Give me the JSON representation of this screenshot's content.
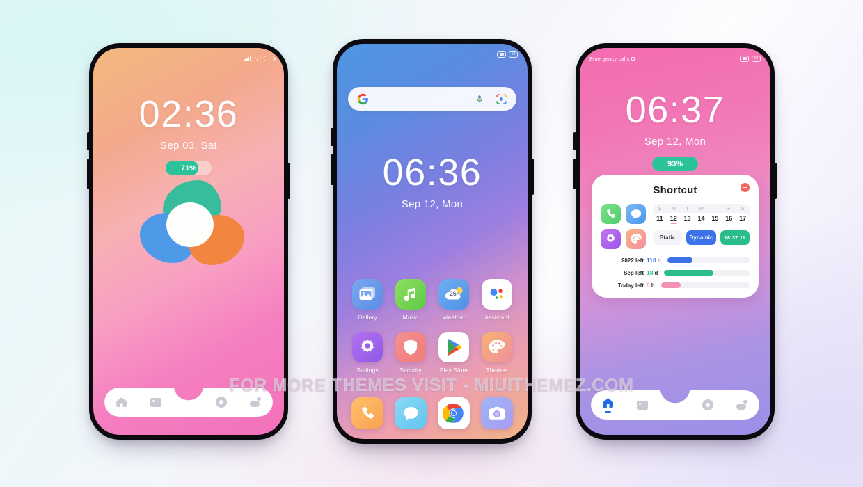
{
  "watermark": "FOR MORE THEMES VISIT - MIUITHEMEZ.COM",
  "background": {
    "accent_mint": "#e4f8f8",
    "accent_lavender": "#eae6fa"
  },
  "phones": {
    "lockscreen": {
      "status_bar": {
        "left_text": "",
        "icons": [
          "signal-icon",
          "wifi-icon",
          "battery-icon"
        ]
      },
      "clock": {
        "time": "02:36",
        "date": "Sep 03, Sat"
      },
      "battery_pill": {
        "label": "71%",
        "percent": 71,
        "fill_color": "#2bc39a"
      },
      "logo": {
        "name": "clover-logo",
        "petal_top_color": "#37bd9b",
        "petal_left_color": "#4f9ae8",
        "petal_right_color": "#f2853f",
        "core_color": "#fdfdfb"
      },
      "nav": [
        {
          "name": "home",
          "icon": "home-icon",
          "active": false
        },
        {
          "name": "gallery",
          "icon": "gallery-icon",
          "active": false
        },
        {
          "name": "record",
          "icon": "circle-record-icon",
          "active": false
        },
        {
          "name": "weather",
          "icon": "weather-cloud-sun-icon",
          "active": false
        }
      ]
    },
    "homescreen": {
      "status_bar": {
        "left_text": "",
        "badges": [
          "camera-badge",
          "battery-badge"
        ]
      },
      "search": {
        "placeholder": "",
        "google_icon": "google-g-icon",
        "mic_icon": "microphone-icon",
        "lens_icon": "google-lens-icon"
      },
      "clock": {
        "time": "06:36",
        "date": "Sep 12, Mon"
      },
      "apps": [
        {
          "label": "Gallery",
          "icon": "gallery-app-icon"
        },
        {
          "label": "Music",
          "icon": "music-note-icon"
        },
        {
          "label": "Weather",
          "icon": "weather-app-icon",
          "temperature": "26°"
        },
        {
          "label": "Assistant",
          "icon": "google-assistant-icon"
        },
        {
          "label": "Settings",
          "icon": "settings-gear-icon"
        },
        {
          "label": "Security",
          "icon": "security-shield-icon"
        },
        {
          "label": "Play Store",
          "icon": "play-store-icon"
        },
        {
          "label": "Themes",
          "icon": "themes-palette-icon"
        }
      ],
      "dock": [
        {
          "label": "Phone",
          "icon": "phone-handset-icon"
        },
        {
          "label": "Messages",
          "icon": "message-bubble-icon"
        },
        {
          "label": "Chrome",
          "icon": "chrome-icon"
        },
        {
          "label": "Camera",
          "icon": "camera-icon"
        }
      ]
    },
    "widgetscreen": {
      "status_bar": {
        "left_text": "Emergency calls",
        "badges": [
          "camera-badge",
          "battery-badge"
        ]
      },
      "clock": {
        "time": "06:37",
        "date": "Sep 12, Mon"
      },
      "battery_pill": {
        "label": "93%",
        "percent": 100,
        "fill_color": "#2bc39a"
      },
      "shortcut": {
        "title": "Shortcut",
        "close_icon": "minus-circle-icon",
        "icons": [
          {
            "name": "phone-shortcut-icon",
            "color": "#5bd074"
          },
          {
            "name": "messages-shortcut-icon",
            "color": "#57a5f0"
          },
          {
            "name": "settings-shortcut-icon",
            "color": "#b064e8"
          },
          {
            "name": "themes-shortcut-icon",
            "color": "#f3a07e"
          }
        ],
        "calendar": {
          "weekdays": [
            "S",
            "M",
            "T",
            "W",
            "T",
            "F",
            "S"
          ],
          "dates": [
            "11",
            "12",
            "13",
            "14",
            "15",
            "16",
            "17"
          ],
          "today_index": 1
        },
        "buttons": [
          {
            "label": "Static",
            "style": "light"
          },
          {
            "label": "Dynamic",
            "style": "blue"
          },
          {
            "label": "18:37:11",
            "style": "green"
          }
        ],
        "bars": [
          {
            "label": "2022 left",
            "value": "110",
            "unit": "d",
            "percent": 31,
            "color": "#3b72e8"
          },
          {
            "label": "Sep left",
            "value": "18",
            "unit": "d",
            "percent": 58,
            "color": "#29bd8e"
          },
          {
            "label": "Today left",
            "value": "5",
            "unit": "h",
            "percent": 22,
            "color": "#f48fb6"
          }
        ]
      },
      "nav": [
        {
          "name": "home",
          "icon": "home-icon",
          "active": true
        },
        {
          "name": "gallery",
          "icon": "gallery-icon",
          "active": false
        },
        {
          "name": "record",
          "icon": "circle-record-icon",
          "active": false
        },
        {
          "name": "weather",
          "icon": "weather-cloud-sun-icon",
          "active": false
        }
      ]
    }
  }
}
